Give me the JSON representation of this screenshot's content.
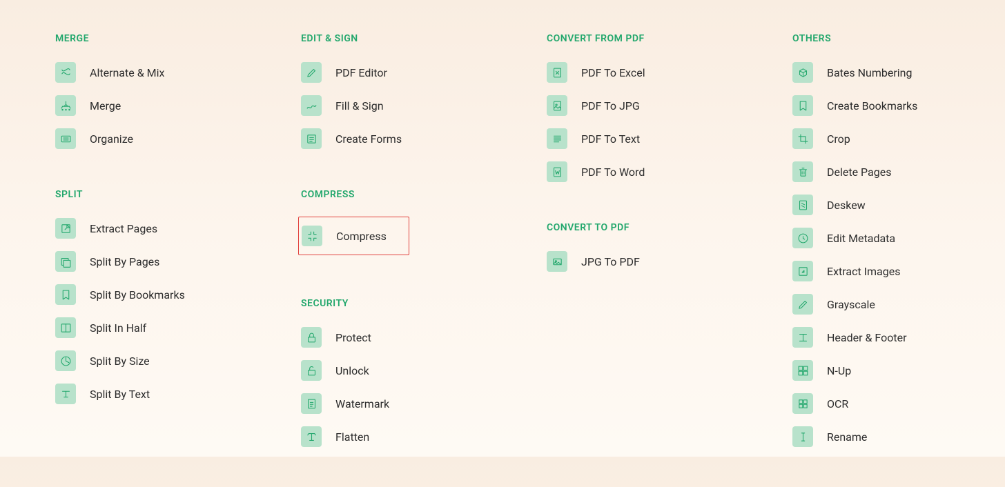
{
  "columns": [
    {
      "sections": [
        {
          "title": "MERGE",
          "items": [
            {
              "label": "Alternate & Mix",
              "icon": "alternate-mix-icon"
            },
            {
              "label": "Merge",
              "icon": "merge-icon"
            },
            {
              "label": "Organize",
              "icon": "organize-icon"
            }
          ]
        },
        {
          "title": "SPLIT",
          "items": [
            {
              "label": "Extract Pages",
              "icon": "extract-pages-icon"
            },
            {
              "label": "Split By Pages",
              "icon": "split-pages-icon"
            },
            {
              "label": "Split By Bookmarks",
              "icon": "split-bookmarks-icon"
            },
            {
              "label": "Split In Half",
              "icon": "split-half-icon"
            },
            {
              "label": "Split By Size",
              "icon": "split-size-icon"
            },
            {
              "label": "Split By Text",
              "icon": "split-text-icon"
            }
          ]
        }
      ]
    },
    {
      "sections": [
        {
          "title": "EDIT & SIGN",
          "items": [
            {
              "label": "PDF Editor",
              "icon": "editor-icon"
            },
            {
              "label": "Fill & Sign",
              "icon": "fill-sign-icon"
            },
            {
              "label": "Create Forms",
              "icon": "create-forms-icon"
            }
          ]
        },
        {
          "title": "COMPRESS",
          "items": [
            {
              "label": "Compress",
              "icon": "compress-icon",
              "highlighted": true
            }
          ]
        },
        {
          "title": "SECURITY",
          "items": [
            {
              "label": "Protect",
              "icon": "protect-icon"
            },
            {
              "label": "Unlock",
              "icon": "unlock-icon"
            },
            {
              "label": "Watermark",
              "icon": "watermark-icon"
            },
            {
              "label": "Flatten",
              "icon": "flatten-icon"
            }
          ]
        }
      ]
    },
    {
      "sections": [
        {
          "title": "CONVERT FROM PDF",
          "items": [
            {
              "label": "PDF To Excel",
              "icon": "to-excel-icon"
            },
            {
              "label": "PDF To JPG",
              "icon": "to-jpg-icon"
            },
            {
              "label": "PDF To Text",
              "icon": "to-text-icon"
            },
            {
              "label": "PDF To Word",
              "icon": "to-word-icon"
            }
          ]
        },
        {
          "title": "CONVERT TO PDF",
          "items": [
            {
              "label": "JPG To PDF",
              "icon": "jpg-to-pdf-icon"
            }
          ]
        }
      ]
    },
    {
      "sections": [
        {
          "title": "OTHERS",
          "items": [
            {
              "label": "Bates Numbering",
              "icon": "bates-icon"
            },
            {
              "label": "Create Bookmarks",
              "icon": "create-bookmarks-icon"
            },
            {
              "label": "Crop",
              "icon": "crop-icon"
            },
            {
              "label": "Delete Pages",
              "icon": "delete-pages-icon"
            },
            {
              "label": "Deskew",
              "icon": "deskew-icon"
            },
            {
              "label": "Edit Metadata",
              "icon": "edit-metadata-icon"
            },
            {
              "label": "Extract Images",
              "icon": "extract-images-icon"
            },
            {
              "label": "Grayscale",
              "icon": "grayscale-icon"
            },
            {
              "label": "Header & Footer",
              "icon": "header-footer-icon"
            },
            {
              "label": "N-Up",
              "icon": "nup-icon"
            },
            {
              "label": "OCR",
              "icon": "ocr-icon"
            },
            {
              "label": "Rename",
              "icon": "rename-icon"
            }
          ]
        }
      ]
    }
  ]
}
